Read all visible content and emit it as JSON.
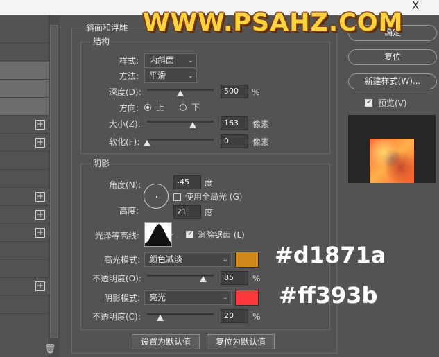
{
  "window": {
    "close_glyph": "X"
  },
  "watermark": {
    "text": "WWW.PSAHZ.COM"
  },
  "bevel_section": {
    "title": "斜面和浮雕",
    "structure": {
      "title": "结构",
      "style": {
        "label": "样式:",
        "value": "内斜面"
      },
      "technique": {
        "label": "方法:",
        "value": "平滑"
      },
      "depth": {
        "label": "深度(D):",
        "value": "500",
        "unit": "%",
        "slider_fraction": 0.45
      },
      "direction": {
        "label": "方向:",
        "options": [
          "上",
          "下"
        ],
        "selected": "上"
      },
      "size": {
        "label": "大小(Z):",
        "value": "163",
        "unit": "像素",
        "slider_fraction": 0.62
      },
      "soften": {
        "label": "软化(F):",
        "value": "0",
        "unit": "像素",
        "slider_fraction": 0.0
      }
    },
    "shading": {
      "title": "阴影",
      "angle": {
        "label": "角度(N):",
        "value": "-45",
        "unit": "度"
      },
      "global_light": {
        "label": "使用全局光 (G)",
        "checked": false
      },
      "altitude": {
        "label": "高度:",
        "value": "21",
        "unit": "度"
      },
      "gloss_contour": {
        "label": "光泽等高线:"
      },
      "anti_aliased": {
        "label": "消除锯齿 (L)",
        "checked": true
      },
      "highlight_mode": {
        "label": "高光模式:",
        "value": "颜色减淡",
        "color": "#d1871a"
      },
      "highlight_opacity": {
        "label": "不透明度(O):",
        "value": "85",
        "unit": "%",
        "slider_fraction": 0.85
      },
      "shadow_mode": {
        "label": "阴影模式:",
        "value": "亮光",
        "color": "#ff393b"
      },
      "shadow_opacity": {
        "label": "不透明度(C):",
        "value": "20",
        "unit": "%",
        "slider_fraction": 0.2
      }
    },
    "make_default": "设置为默认值",
    "reset_default": "复位为默认值"
  },
  "right_buttons": {
    "ok": "确定",
    "reset": "复位",
    "new_style": "新建样式(W)...",
    "preview": {
      "label": "预览(V)",
      "checked": true
    }
  },
  "annotations": {
    "highlight_hex": "#d1871a",
    "shadow_hex": "#ff393b"
  },
  "icons": {
    "plus": "+",
    "trash": "🗑",
    "chevron": "⌄"
  }
}
